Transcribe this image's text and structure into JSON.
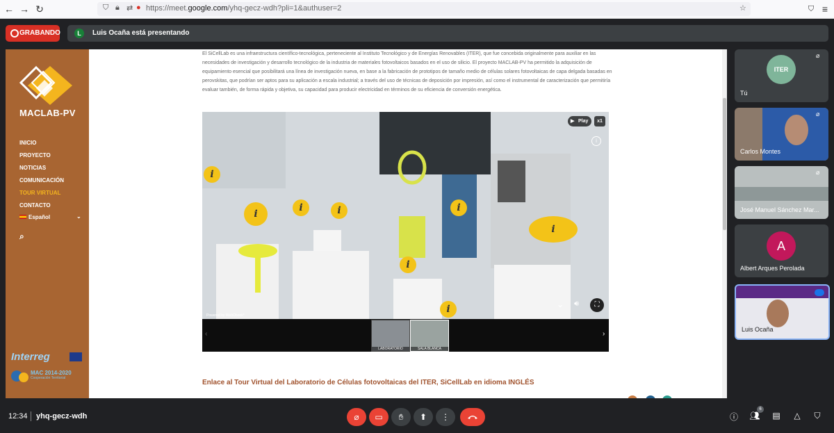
{
  "browser": {
    "url_prefix": "https://meet.",
    "url_domain": "google.com",
    "url_suffix": "/yhq-gecz-wdh?pli=1&authuser=2"
  },
  "meet": {
    "recording_label": "GRABANDO",
    "presenter_initial": "L",
    "presenting_text": "Luis Ocaña está presentando",
    "clock": "12:34",
    "meeting_code": "yhq-gecz-wdh",
    "participants_count": "6"
  },
  "site": {
    "logo_title": "MACLAB-PV",
    "menu": [
      "INICIO",
      "PROYECTO",
      "NOTICIAS",
      "COMUNICACIÓN",
      "TOUR VIRTUAL",
      "CONTACTO"
    ],
    "active_menu": "TOUR VIRTUAL",
    "language": "Español",
    "interreg": "Interreg",
    "mac_title": "MAC 2014-2020",
    "mac_sub": "Cooperación Territorial",
    "paragraph": "El SiCellLab es una infraestructura científico-tecnológica, perteneciente al Instituto Tecnológico y de Energías Renovables (ITER), que fue concebida originalmente para auxiliar en las necesidades de investigación y desarrollo tecnológico de la industria de materiales fotovoltaicos basados en el uso de silicio. El proyecto MACLAB-PV ha permitido la adquisición de equipamiento esencial que posibilitará una línea de investigación nueva, en base a la fabricación de prototipos de tamaño medio de células solares fotovoltaicas de capa delgada basadas en perovskitas, que podrían ser aptos para su aplicación a escala industrial; a través del uso de técnicas de deposición por impresión, así como el instrumental de caracterización que permitiría evaluar también, de forma rápida y objetiva, su capacidad para producir electricidad en términos de su eficiencia de conversión energética.",
    "tour_play": "Play",
    "tour_speed": "x1",
    "tour_powered": "Powered by WebObook*",
    "thumbs": [
      "LABORATORIO",
      "SALA BLANCA"
    ],
    "link_text": "Enlace al Tour Virtual del Laboratorio de Células fotovoltaicas del ITER, SiCellLab en idioma INGLÉS"
  },
  "participants": [
    {
      "name": "Tú",
      "avatar": "ITER",
      "type": "logo"
    },
    {
      "name": "Carlos Montes",
      "type": "video"
    },
    {
      "name": "José Manuel Sánchez Mar...",
      "type": "video"
    },
    {
      "name": "Albert Arques Perolada",
      "avatar": "A",
      "type": "initial"
    },
    {
      "name": "Luis Ocaña",
      "type": "video"
    }
  ],
  "colors": {
    "sidebar": "#a86532",
    "accent": "#f4b51e",
    "recording": "#d93025",
    "link": "#a0522d",
    "avatar_albert": "#c2185b"
  }
}
